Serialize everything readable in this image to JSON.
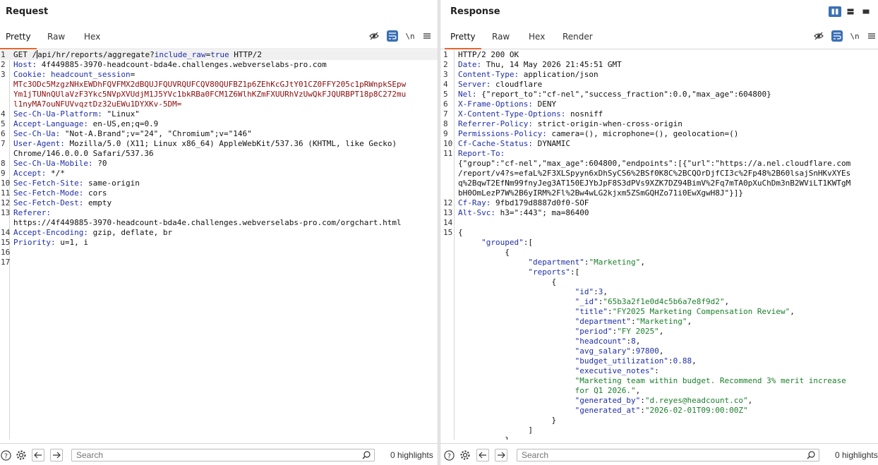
{
  "request": {
    "title": "Request",
    "tabs": [
      "Pretty",
      "Raw",
      "Hex"
    ],
    "newline_label": "\\n",
    "lines": [
      {
        "n": "1",
        "parts": [
          [
            "v",
            "GET /"
          ],
          [
            "caret",
            ""
          ],
          [
            "v",
            "api/hr/reports/aggregate?"
          ],
          [
            "param",
            "include_raw"
          ],
          [
            "v",
            "="
          ],
          [
            "param",
            "true"
          ],
          [
            "v",
            " HTTP/2"
          ]
        ],
        "hl": true
      },
      {
        "n": "2",
        "parts": [
          [
            "k",
            "Host:"
          ],
          [
            "v",
            " 4f449885-3970-headcount-bda4e.challenges.webverselabs-pro.com"
          ]
        ]
      },
      {
        "n": "3",
        "parts": [
          [
            "k",
            "Cookie:"
          ],
          [
            "v",
            " "
          ],
          [
            "k",
            "headcount_session"
          ],
          [
            "v",
            "="
          ]
        ]
      },
      {
        "n": "",
        "parts": [
          [
            "cookie",
            "MTc3ODc5MzgzNHxEWDhFQVFMX2dBQUJFQUVRQUFCQV80QUFBZ1p6ZEhKcGJtY01CZ0FFY205c1pRWnpkSEpw"
          ]
        ]
      },
      {
        "n": "",
        "parts": [
          [
            "cookie",
            "Ym1jTUNnQUlaVzF3Ykc5NVpXVUdjM1J5YVc1bkRBa0FCM1Z6WlhKZmFXUURhVzUwQkFJQURBPT18p8C272mu"
          ]
        ]
      },
      {
        "n": "",
        "parts": [
          [
            "cookie",
            "l1nyMA7ouNFUVvqztDz32uEWu1DYXKv-5DM="
          ]
        ]
      },
      {
        "n": "4",
        "parts": [
          [
            "k",
            "Sec-Ch-Ua-Platform:"
          ],
          [
            "v",
            " \"Linux\""
          ]
        ]
      },
      {
        "n": "5",
        "parts": [
          [
            "k",
            "Accept-Language:"
          ],
          [
            "v",
            " en-US,en;q=0.9"
          ]
        ]
      },
      {
        "n": "6",
        "parts": [
          [
            "k",
            "Sec-Ch-Ua:"
          ],
          [
            "v",
            " \"Not-A.Brand\";v=\"24\", \"Chromium\";v=\"146\""
          ]
        ]
      },
      {
        "n": "7",
        "parts": [
          [
            "k",
            "User-Agent:"
          ],
          [
            "v",
            " Mozilla/5.0 (X11; Linux x86_64) AppleWebKit/537.36 (KHTML, like Gecko)"
          ]
        ]
      },
      {
        "n": "",
        "parts": [
          [
            "v",
            "Chrome/146.0.0.0 Safari/537.36"
          ]
        ]
      },
      {
        "n": "8",
        "parts": [
          [
            "k",
            "Sec-Ch-Ua-Mobile:"
          ],
          [
            "v",
            " ?0"
          ]
        ]
      },
      {
        "n": "9",
        "parts": [
          [
            "k",
            "Accept:"
          ],
          [
            "v",
            " */*"
          ]
        ]
      },
      {
        "n": "10",
        "parts": [
          [
            "k",
            "Sec-Fetch-Site:"
          ],
          [
            "v",
            " same-origin"
          ]
        ]
      },
      {
        "n": "11",
        "parts": [
          [
            "k",
            "Sec-Fetch-Mode:"
          ],
          [
            "v",
            " cors"
          ]
        ]
      },
      {
        "n": "12",
        "parts": [
          [
            "k",
            "Sec-Fetch-Dest:"
          ],
          [
            "v",
            " empty"
          ]
        ]
      },
      {
        "n": "13",
        "parts": [
          [
            "k",
            "Referer:"
          ]
        ]
      },
      {
        "n": "",
        "parts": [
          [
            "v",
            "https://4f449885-3970-headcount-bda4e.challenges.webverselabs-pro.com/orgchart.html"
          ]
        ]
      },
      {
        "n": "14",
        "parts": [
          [
            "k",
            "Accept-Encoding:"
          ],
          [
            "v",
            " gzip, deflate, br"
          ]
        ]
      },
      {
        "n": "15",
        "parts": [
          [
            "k",
            "Priority:"
          ],
          [
            "v",
            " u=1, i"
          ]
        ]
      },
      {
        "n": "16",
        "parts": []
      },
      {
        "n": "17",
        "parts": []
      }
    ],
    "search_placeholder": "Search",
    "highlights": "0 highlights"
  },
  "response": {
    "title": "Response",
    "tabs": [
      "Pretty",
      "Raw",
      "Hex",
      "Render"
    ],
    "newline_label": "\\n",
    "lines": [
      {
        "n": "1",
        "parts": [
          [
            "v",
            "HTTP/2 200 OK"
          ]
        ]
      },
      {
        "n": "2",
        "parts": [
          [
            "k",
            "Date:"
          ],
          [
            "v",
            " Thu, 14 May 2026 21:45:51 GMT"
          ]
        ]
      },
      {
        "n": "3",
        "parts": [
          [
            "k",
            "Content-Type:"
          ],
          [
            "v",
            " application/json"
          ]
        ]
      },
      {
        "n": "4",
        "parts": [
          [
            "k",
            "Server:"
          ],
          [
            "v",
            " cloudflare"
          ]
        ]
      },
      {
        "n": "5",
        "parts": [
          [
            "k",
            "Nel:"
          ],
          [
            "v",
            " {\"report_to\":\"cf-nel\",\"success_fraction\":0.0,\"max_age\":604800}"
          ]
        ]
      },
      {
        "n": "6",
        "parts": [
          [
            "k",
            "X-Frame-Options:"
          ],
          [
            "v",
            " DENY"
          ]
        ]
      },
      {
        "n": "7",
        "parts": [
          [
            "k",
            "X-Content-Type-Options:"
          ],
          [
            "v",
            " nosniff"
          ]
        ]
      },
      {
        "n": "8",
        "parts": [
          [
            "k",
            "Referrer-Policy:"
          ],
          [
            "v",
            " strict-origin-when-cross-origin"
          ]
        ]
      },
      {
        "n": "9",
        "parts": [
          [
            "k",
            "Permissions-Policy:"
          ],
          [
            "v",
            " camera=(), microphone=(), geolocation=()"
          ]
        ]
      },
      {
        "n": "10",
        "parts": [
          [
            "k",
            "Cf-Cache-Status:"
          ],
          [
            "v",
            " DYNAMIC"
          ]
        ]
      },
      {
        "n": "11",
        "parts": [
          [
            "k",
            "Report-To:"
          ]
        ]
      },
      {
        "n": "",
        "parts": [
          [
            "v",
            "{\"group\":\"cf-nel\",\"max_age\":604800,\"endpoints\":[{\"url\":\"https://a.nel.cloudflare.com"
          ]
        ]
      },
      {
        "n": "",
        "parts": [
          [
            "v",
            "/report/v4?s=efaL%2F3XLSpyyn6xDhSyCS6%2BSf0K8C%2BCQOrDjfCI3c%2Fp48%2B60lsajSnHKvXYEs"
          ]
        ]
      },
      {
        "n": "",
        "parts": [
          [
            "v",
            "q%2BqwT2EfNm99fnyJeg3AT150EJYbJpF8S3dPVs9XZK7DZ94BimV%2Fq7mTA0pXuChDm3nB2WViLT1KWTgM"
          ]
        ]
      },
      {
        "n": "",
        "parts": [
          [
            "v",
            "bH0OmLezP7W%2B6yIRM%2Fl%2Bw4wLG2kjxm5ZSmGQHZo71i0EwXgwH8J\"}]}"
          ]
        ]
      },
      {
        "n": "12",
        "parts": [
          [
            "k",
            "Cf-Ray:"
          ],
          [
            "v",
            " 9fbd179d8887d0f0-SOF"
          ]
        ]
      },
      {
        "n": "13",
        "parts": [
          [
            "k",
            "Alt-Svc:"
          ],
          [
            "v",
            " h3=\":443\"; ma=86400"
          ]
        ]
      },
      {
        "n": "14",
        "parts": []
      },
      {
        "n": "15",
        "parts": [
          [
            "jp",
            "{"
          ]
        ]
      },
      {
        "n": "",
        "parts": [
          [
            "jp",
            "     "
          ],
          [
            "jk",
            "\"grouped\""
          ],
          [
            "jp",
            ":["
          ]
        ]
      },
      {
        "n": "",
        "parts": [
          [
            "jp",
            "          {"
          ]
        ]
      },
      {
        "n": "",
        "parts": [
          [
            "jp",
            "               "
          ],
          [
            "jk",
            "\"department\""
          ],
          [
            "jp",
            ":"
          ],
          [
            "js",
            "\"Marketing\""
          ],
          [
            "jp",
            ","
          ]
        ]
      },
      {
        "n": "",
        "parts": [
          [
            "jp",
            "               "
          ],
          [
            "jk",
            "\"reports\""
          ],
          [
            "jp",
            ":["
          ]
        ]
      },
      {
        "n": "",
        "parts": [
          [
            "jp",
            "                    {"
          ]
        ]
      },
      {
        "n": "",
        "parts": [
          [
            "jp",
            "                         "
          ],
          [
            "jk",
            "\"id\""
          ],
          [
            "jp",
            ":"
          ],
          [
            "jn",
            "3"
          ],
          [
            "jp",
            ","
          ]
        ]
      },
      {
        "n": "",
        "parts": [
          [
            "jp",
            "                         "
          ],
          [
            "jk",
            "\"_id\""
          ],
          [
            "jp",
            ":"
          ],
          [
            "js",
            "\"65b3a2f1e0d4c5b6a7e8f9d2\""
          ],
          [
            "jp",
            ","
          ]
        ]
      },
      {
        "n": "",
        "parts": [
          [
            "jp",
            "                         "
          ],
          [
            "jk",
            "\"title\""
          ],
          [
            "jp",
            ":"
          ],
          [
            "js",
            "\"FY2025 Marketing Compensation Review\""
          ],
          [
            "jp",
            ","
          ]
        ]
      },
      {
        "n": "",
        "parts": [
          [
            "jp",
            "                         "
          ],
          [
            "jk",
            "\"department\""
          ],
          [
            "jp",
            ":"
          ],
          [
            "js",
            "\"Marketing\""
          ],
          [
            "jp",
            ","
          ]
        ]
      },
      {
        "n": "",
        "parts": [
          [
            "jp",
            "                         "
          ],
          [
            "jk",
            "\"period\""
          ],
          [
            "jp",
            ":"
          ],
          [
            "js",
            "\"FY 2025\""
          ],
          [
            "jp",
            ","
          ]
        ]
      },
      {
        "n": "",
        "parts": [
          [
            "jp",
            "                         "
          ],
          [
            "jk",
            "\"headcount\""
          ],
          [
            "jp",
            ":"
          ],
          [
            "jn",
            "8"
          ],
          [
            "jp",
            ","
          ]
        ]
      },
      {
        "n": "",
        "parts": [
          [
            "jp",
            "                         "
          ],
          [
            "jk",
            "\"avg_salary\""
          ],
          [
            "jp",
            ":"
          ],
          [
            "jn",
            "97800"
          ],
          [
            "jp",
            ","
          ]
        ]
      },
      {
        "n": "",
        "parts": [
          [
            "jp",
            "                         "
          ],
          [
            "jk",
            "\"budget_utilization\""
          ],
          [
            "jp",
            ":"
          ],
          [
            "jn",
            "0.88"
          ],
          [
            "jp",
            ","
          ]
        ]
      },
      {
        "n": "",
        "parts": [
          [
            "jp",
            "                         "
          ],
          [
            "jk",
            "\"executive_notes\""
          ],
          [
            "jp",
            ":"
          ]
        ]
      },
      {
        "n": "",
        "parts": [
          [
            "jp",
            "                         "
          ],
          [
            "js",
            "\"Marketing team within budget. Recommend 3% merit increase"
          ]
        ]
      },
      {
        "n": "",
        "parts": [
          [
            "jp",
            "                         "
          ],
          [
            "js",
            "for Q1 2026.\""
          ],
          [
            "jp",
            ","
          ]
        ]
      },
      {
        "n": "",
        "parts": [
          [
            "jp",
            "                         "
          ],
          [
            "jk",
            "\"generated_by\""
          ],
          [
            "jp",
            ":"
          ],
          [
            "js",
            "\"d.reyes@headcount.co\""
          ],
          [
            "jp",
            ","
          ]
        ]
      },
      {
        "n": "",
        "parts": [
          [
            "jp",
            "                         "
          ],
          [
            "jk",
            "\"generated_at\""
          ],
          [
            "jp",
            ":"
          ],
          [
            "js",
            "\"2026-02-01T09:00:00Z\""
          ]
        ]
      },
      {
        "n": "",
        "parts": [
          [
            "jp",
            "                    }"
          ]
        ]
      },
      {
        "n": "",
        "parts": [
          [
            "jp",
            "               ]"
          ]
        ]
      },
      {
        "n": "",
        "parts": [
          [
            "jp",
            "          },"
          ]
        ]
      }
    ],
    "search_placeholder": "Search",
    "highlights": "0 highlights"
  }
}
